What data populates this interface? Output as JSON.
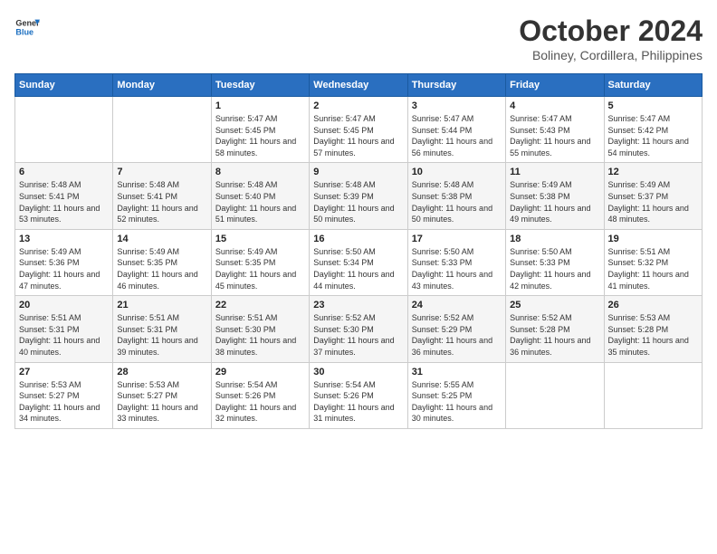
{
  "logo": {
    "line1": "General",
    "line2": "Blue"
  },
  "title": "October 2024",
  "location": "Boliney, Cordillera, Philippines",
  "days_of_week": [
    "Sunday",
    "Monday",
    "Tuesday",
    "Wednesday",
    "Thursday",
    "Friday",
    "Saturday"
  ],
  "weeks": [
    [
      {
        "day": "",
        "sunrise": "",
        "sunset": "",
        "daylight": ""
      },
      {
        "day": "",
        "sunrise": "",
        "sunset": "",
        "daylight": ""
      },
      {
        "day": "1",
        "sunrise": "Sunrise: 5:47 AM",
        "sunset": "Sunset: 5:45 PM",
        "daylight": "Daylight: 11 hours and 58 minutes."
      },
      {
        "day": "2",
        "sunrise": "Sunrise: 5:47 AM",
        "sunset": "Sunset: 5:45 PM",
        "daylight": "Daylight: 11 hours and 57 minutes."
      },
      {
        "day": "3",
        "sunrise": "Sunrise: 5:47 AM",
        "sunset": "Sunset: 5:44 PM",
        "daylight": "Daylight: 11 hours and 56 minutes."
      },
      {
        "day": "4",
        "sunrise": "Sunrise: 5:47 AM",
        "sunset": "Sunset: 5:43 PM",
        "daylight": "Daylight: 11 hours and 55 minutes."
      },
      {
        "day": "5",
        "sunrise": "Sunrise: 5:47 AM",
        "sunset": "Sunset: 5:42 PM",
        "daylight": "Daylight: 11 hours and 54 minutes."
      }
    ],
    [
      {
        "day": "6",
        "sunrise": "Sunrise: 5:48 AM",
        "sunset": "Sunset: 5:41 PM",
        "daylight": "Daylight: 11 hours and 53 minutes."
      },
      {
        "day": "7",
        "sunrise": "Sunrise: 5:48 AM",
        "sunset": "Sunset: 5:41 PM",
        "daylight": "Daylight: 11 hours and 52 minutes."
      },
      {
        "day": "8",
        "sunrise": "Sunrise: 5:48 AM",
        "sunset": "Sunset: 5:40 PM",
        "daylight": "Daylight: 11 hours and 51 minutes."
      },
      {
        "day": "9",
        "sunrise": "Sunrise: 5:48 AM",
        "sunset": "Sunset: 5:39 PM",
        "daylight": "Daylight: 11 hours and 50 minutes."
      },
      {
        "day": "10",
        "sunrise": "Sunrise: 5:48 AM",
        "sunset": "Sunset: 5:38 PM",
        "daylight": "Daylight: 11 hours and 50 minutes."
      },
      {
        "day": "11",
        "sunrise": "Sunrise: 5:49 AM",
        "sunset": "Sunset: 5:38 PM",
        "daylight": "Daylight: 11 hours and 49 minutes."
      },
      {
        "day": "12",
        "sunrise": "Sunrise: 5:49 AM",
        "sunset": "Sunset: 5:37 PM",
        "daylight": "Daylight: 11 hours and 48 minutes."
      }
    ],
    [
      {
        "day": "13",
        "sunrise": "Sunrise: 5:49 AM",
        "sunset": "Sunset: 5:36 PM",
        "daylight": "Daylight: 11 hours and 47 minutes."
      },
      {
        "day": "14",
        "sunrise": "Sunrise: 5:49 AM",
        "sunset": "Sunset: 5:35 PM",
        "daylight": "Daylight: 11 hours and 46 minutes."
      },
      {
        "day": "15",
        "sunrise": "Sunrise: 5:49 AM",
        "sunset": "Sunset: 5:35 PM",
        "daylight": "Daylight: 11 hours and 45 minutes."
      },
      {
        "day": "16",
        "sunrise": "Sunrise: 5:50 AM",
        "sunset": "Sunset: 5:34 PM",
        "daylight": "Daylight: 11 hours and 44 minutes."
      },
      {
        "day": "17",
        "sunrise": "Sunrise: 5:50 AM",
        "sunset": "Sunset: 5:33 PM",
        "daylight": "Daylight: 11 hours and 43 minutes."
      },
      {
        "day": "18",
        "sunrise": "Sunrise: 5:50 AM",
        "sunset": "Sunset: 5:33 PM",
        "daylight": "Daylight: 11 hours and 42 minutes."
      },
      {
        "day": "19",
        "sunrise": "Sunrise: 5:51 AM",
        "sunset": "Sunset: 5:32 PM",
        "daylight": "Daylight: 11 hours and 41 minutes."
      }
    ],
    [
      {
        "day": "20",
        "sunrise": "Sunrise: 5:51 AM",
        "sunset": "Sunset: 5:31 PM",
        "daylight": "Daylight: 11 hours and 40 minutes."
      },
      {
        "day": "21",
        "sunrise": "Sunrise: 5:51 AM",
        "sunset": "Sunset: 5:31 PM",
        "daylight": "Daylight: 11 hours and 39 minutes."
      },
      {
        "day": "22",
        "sunrise": "Sunrise: 5:51 AM",
        "sunset": "Sunset: 5:30 PM",
        "daylight": "Daylight: 11 hours and 38 minutes."
      },
      {
        "day": "23",
        "sunrise": "Sunrise: 5:52 AM",
        "sunset": "Sunset: 5:30 PM",
        "daylight": "Daylight: 11 hours and 37 minutes."
      },
      {
        "day": "24",
        "sunrise": "Sunrise: 5:52 AM",
        "sunset": "Sunset: 5:29 PM",
        "daylight": "Daylight: 11 hours and 36 minutes."
      },
      {
        "day": "25",
        "sunrise": "Sunrise: 5:52 AM",
        "sunset": "Sunset: 5:28 PM",
        "daylight": "Daylight: 11 hours and 36 minutes."
      },
      {
        "day": "26",
        "sunrise": "Sunrise: 5:53 AM",
        "sunset": "Sunset: 5:28 PM",
        "daylight": "Daylight: 11 hours and 35 minutes."
      }
    ],
    [
      {
        "day": "27",
        "sunrise": "Sunrise: 5:53 AM",
        "sunset": "Sunset: 5:27 PM",
        "daylight": "Daylight: 11 hours and 34 minutes."
      },
      {
        "day": "28",
        "sunrise": "Sunrise: 5:53 AM",
        "sunset": "Sunset: 5:27 PM",
        "daylight": "Daylight: 11 hours and 33 minutes."
      },
      {
        "day": "29",
        "sunrise": "Sunrise: 5:54 AM",
        "sunset": "Sunset: 5:26 PM",
        "daylight": "Daylight: 11 hours and 32 minutes."
      },
      {
        "day": "30",
        "sunrise": "Sunrise: 5:54 AM",
        "sunset": "Sunset: 5:26 PM",
        "daylight": "Daylight: 11 hours and 31 minutes."
      },
      {
        "day": "31",
        "sunrise": "Sunrise: 5:55 AM",
        "sunset": "Sunset: 5:25 PM",
        "daylight": "Daylight: 11 hours and 30 minutes."
      },
      {
        "day": "",
        "sunrise": "",
        "sunset": "",
        "daylight": ""
      },
      {
        "day": "",
        "sunrise": "",
        "sunset": "",
        "daylight": ""
      }
    ]
  ]
}
